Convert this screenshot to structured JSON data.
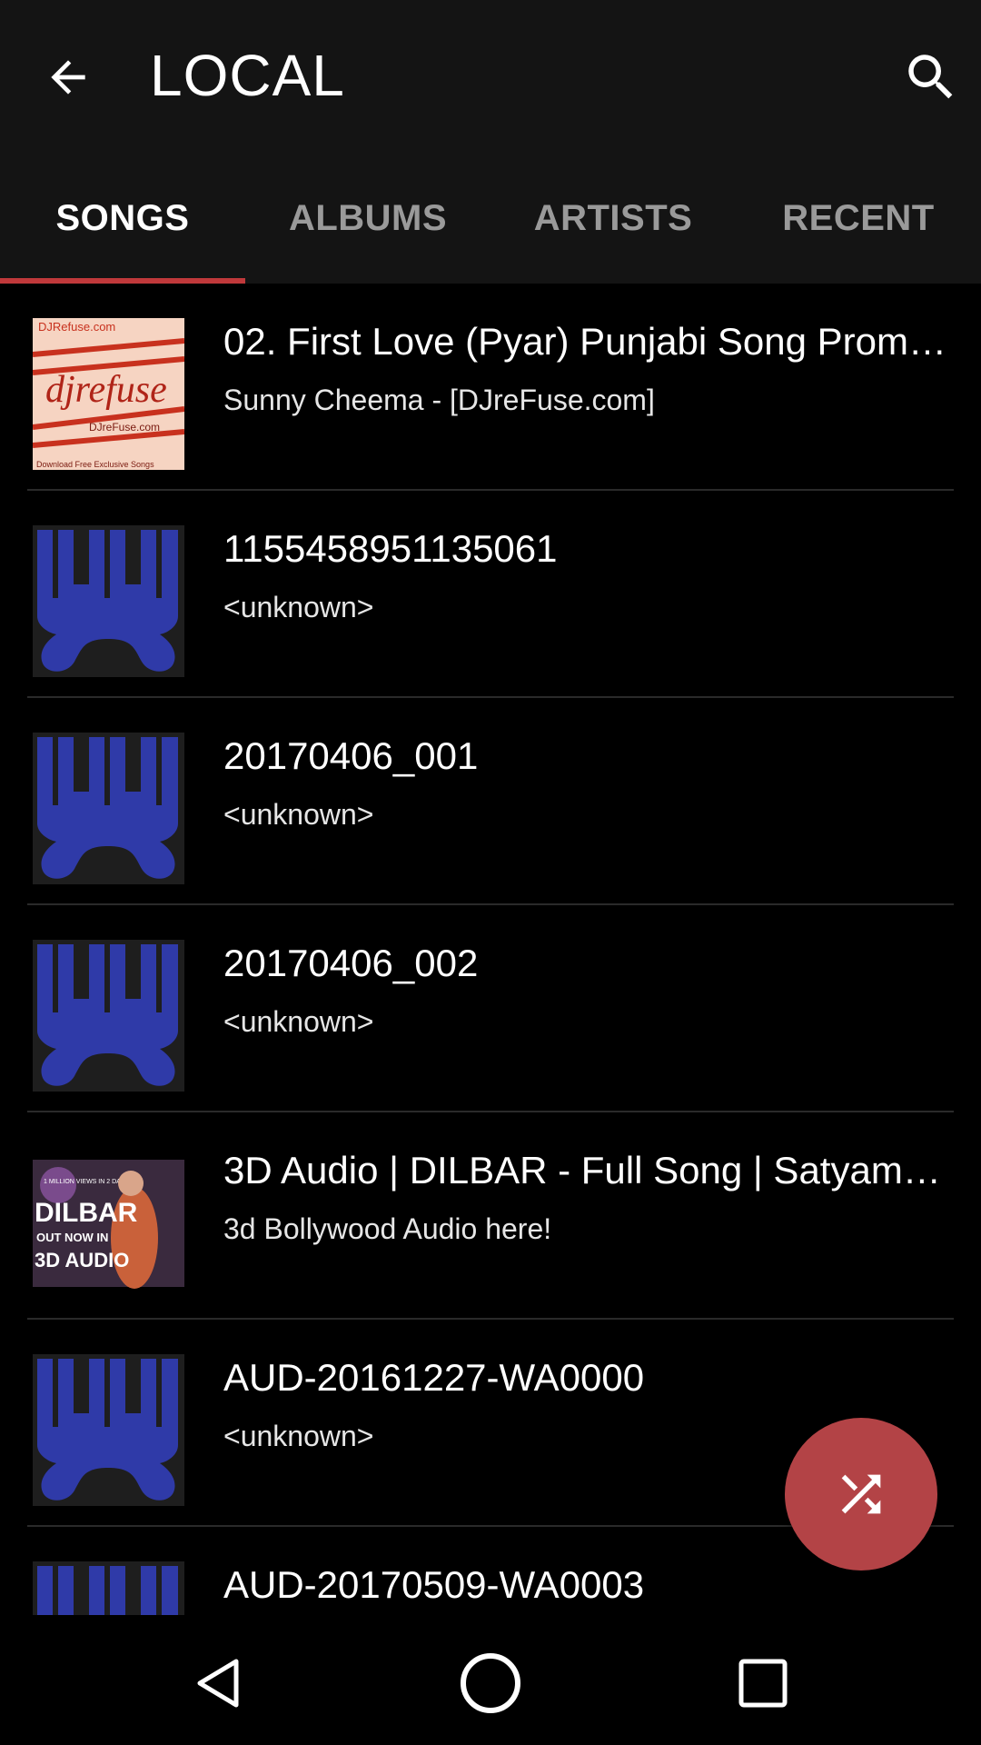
{
  "appbar": {
    "title": "LOCAL",
    "back_icon": "arrow-left-icon",
    "search_icon": "search-icon"
  },
  "tabs": [
    {
      "label": "SONGS",
      "active": true
    },
    {
      "label": "ALBUMS",
      "active": false
    },
    {
      "label": "ARTISTS",
      "active": false
    },
    {
      "label": "RECENT",
      "active": false
    }
  ],
  "songs": [
    {
      "title": "02. First Love (Pyar) Punjabi Song Promo ...",
      "artist": "Sunny Cheema - [DJreFuse.com]",
      "art": "djrefuse-cover"
    },
    {
      "title": "1155458951135061",
      "artist": "<unknown>",
      "art": "default-cover"
    },
    {
      "title": "20170406_001",
      "artist": "<unknown>",
      "art": "default-cover"
    },
    {
      "title": "20170406_002",
      "artist": "<unknown>",
      "art": "default-cover"
    },
    {
      "title": "3D Audio | DILBAR - Full Song | Satyamev...",
      "artist": "3d Bollywood Audio here!",
      "art": "dilbar-cover"
    },
    {
      "title": "AUD-20161227-WA0000",
      "artist": "<unknown>",
      "art": "default-cover"
    },
    {
      "title": "AUD-20170509-WA0003",
      "artist": "",
      "art": "default-cover"
    }
  ],
  "art_text": {
    "djrefuse_top": "DJRefuse.com",
    "djrefuse_logo": "djrefuse",
    "djrefuse_mid": "DJreFuse.com",
    "djrefuse_bottom": "Download Free Exclusive Songs",
    "dilbar_badge": "1 MILLION VIEWS IN 2 DAYS",
    "dilbar_title": "DILBAR",
    "dilbar_sub": "OUT NOW IN",
    "dilbar_audio": "3D AUDIO"
  },
  "fab": {
    "icon": "shuffle-icon"
  },
  "navbar": {
    "back": "nav-back-icon",
    "home": "nav-home-icon",
    "recents": "nav-recents-icon"
  },
  "colors": {
    "accent": "#c0393b",
    "fab": "#b34346",
    "appbar": "#141414",
    "cover_blue": "#2f3aa8"
  }
}
